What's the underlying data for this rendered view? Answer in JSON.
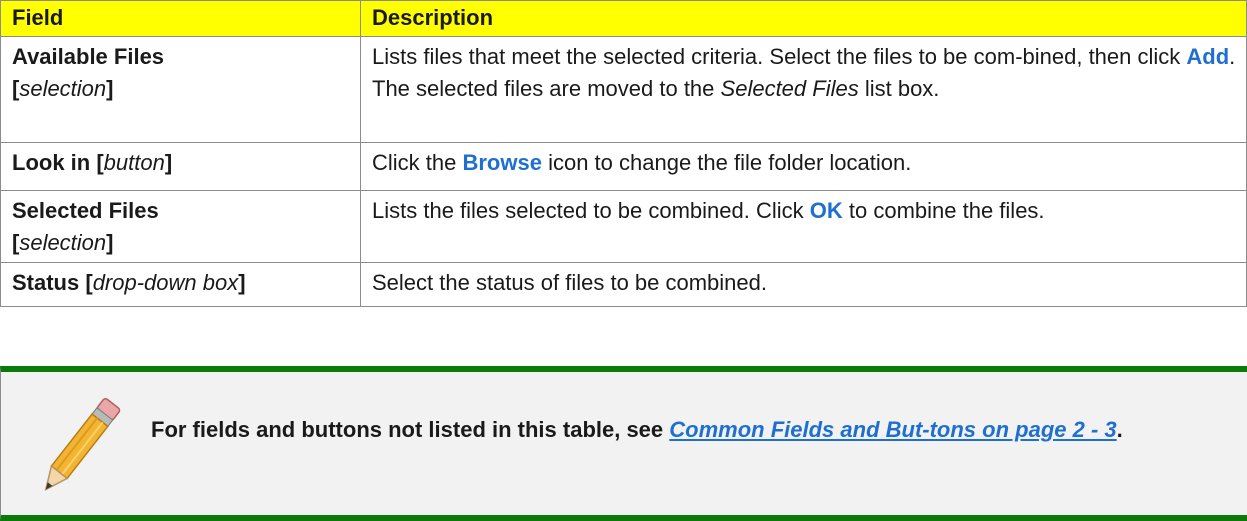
{
  "table": {
    "headers": {
      "field": "Field",
      "description": "Description"
    },
    "rows": [
      {
        "name": "Available Files",
        "open": "[",
        "type": "selection",
        "close": "]",
        "desc": {
          "a": "Lists files that meet the selected criteria. Select the files to be com-bined, then click ",
          "k": "Add",
          "b": ". The selected files are moved to the ",
          "i": "Selected Files",
          "c": " list box."
        }
      },
      {
        "name": "Look in [",
        "type": "button",
        "close": "]",
        "desc": {
          "a": "Click the ",
          "k": "Browse",
          "b": " icon to change the file folder location."
        }
      },
      {
        "name": "Selected Files",
        "open": "[",
        "type": "selection",
        "close": "]",
        "desc": {
          "a": "Lists the files selected to be combined. Click ",
          "k": "OK",
          "b": " to combine the files."
        }
      },
      {
        "name": "Status [",
        "type": "drop-down box",
        "close": "]",
        "desc": {
          "a": "Select the status of files to be combined."
        }
      }
    ]
  },
  "note": {
    "icon": "pencil-icon",
    "prefix": "For fields and buttons not listed in this table, see ",
    "link": "Common Fields and But-tons on page 2 - 3",
    "suffix": "."
  },
  "colors": {
    "header_bg": "#ffff00",
    "keyword": "#1f6fd0",
    "note_border": "#0b7a0b",
    "note_bg": "#f2f2f2"
  }
}
